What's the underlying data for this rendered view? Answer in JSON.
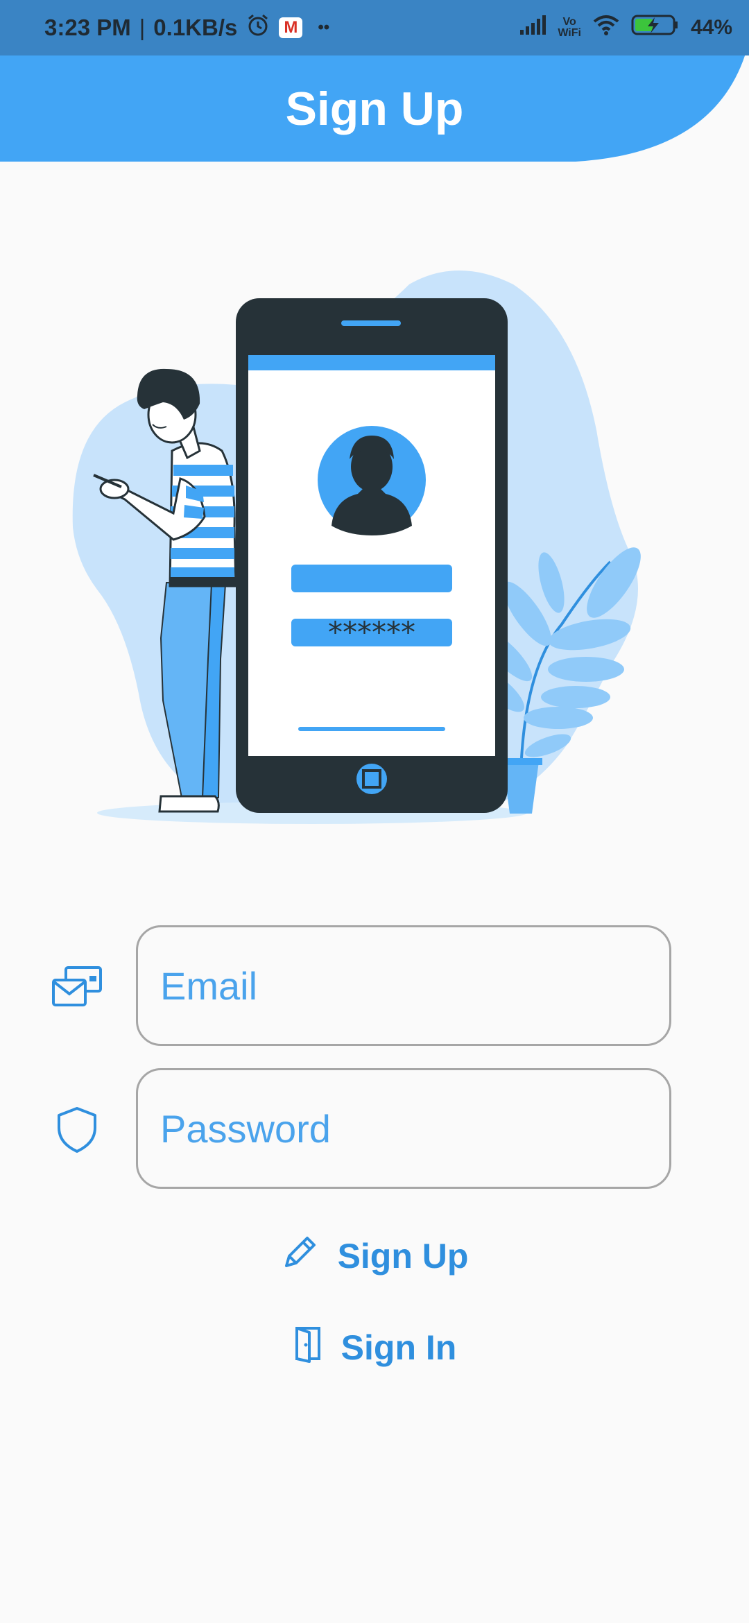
{
  "status_bar": {
    "time": "3:23 PM",
    "separator": "|",
    "speed": "0.1KB/s",
    "gmail_letter": "M",
    "more": "••",
    "volte_top": "Vo",
    "volte_bottom": "WiFi",
    "battery": "44%"
  },
  "header": {
    "title": "Sign Up"
  },
  "illustration": {
    "password_mask": "******"
  },
  "form": {
    "email_placeholder": "Email",
    "password_placeholder": "Password"
  },
  "actions": {
    "signup_label": "Sign Up",
    "signin_label": "Sign In"
  },
  "colors": {
    "primary": "#42a5f5",
    "primary_text": "#2f8fde",
    "status_bar": "#3a84c4",
    "background": "#fafafa",
    "phone_body": "#263238",
    "blob": "#c8e3fb"
  }
}
